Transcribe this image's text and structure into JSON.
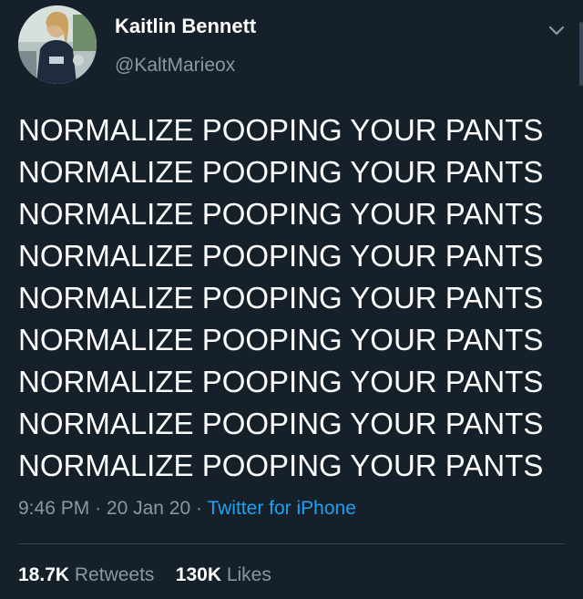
{
  "author": {
    "name": "Kaitlin Bennett",
    "handle": "@KaltMarieox"
  },
  "tweet": {
    "lines": [
      "NORMALIZE POOPING YOUR PANTS",
      "NORMALIZE POOPING YOUR PANTS",
      "NORMALIZE POOPING YOUR PANTS",
      "NORMALIZE POOPING YOUR PANTS",
      "NORMALIZE POOPING YOUR PANTS",
      "NORMALIZE POOPING YOUR PANTS",
      "NORMALIZE POOPING YOUR PANTS",
      "NORMALIZE POOPING YOUR PANTS",
      "NORMALIZE POOPING YOUR PANTS"
    ],
    "time": "9:46 PM",
    "sep": "·",
    "date": "20 Jan 20",
    "source": "Twitter for iPhone"
  },
  "stats": {
    "retweets_count": "18.7K",
    "retweets_label": "Retweets",
    "likes_count": "130K",
    "likes_label": "Likes"
  },
  "icons": {
    "menu": "chevron-down-icon"
  },
  "colors": {
    "background": "#15202b",
    "secondary_text": "#8899a6",
    "link": "#1da1f2",
    "divider": "#38444d"
  }
}
